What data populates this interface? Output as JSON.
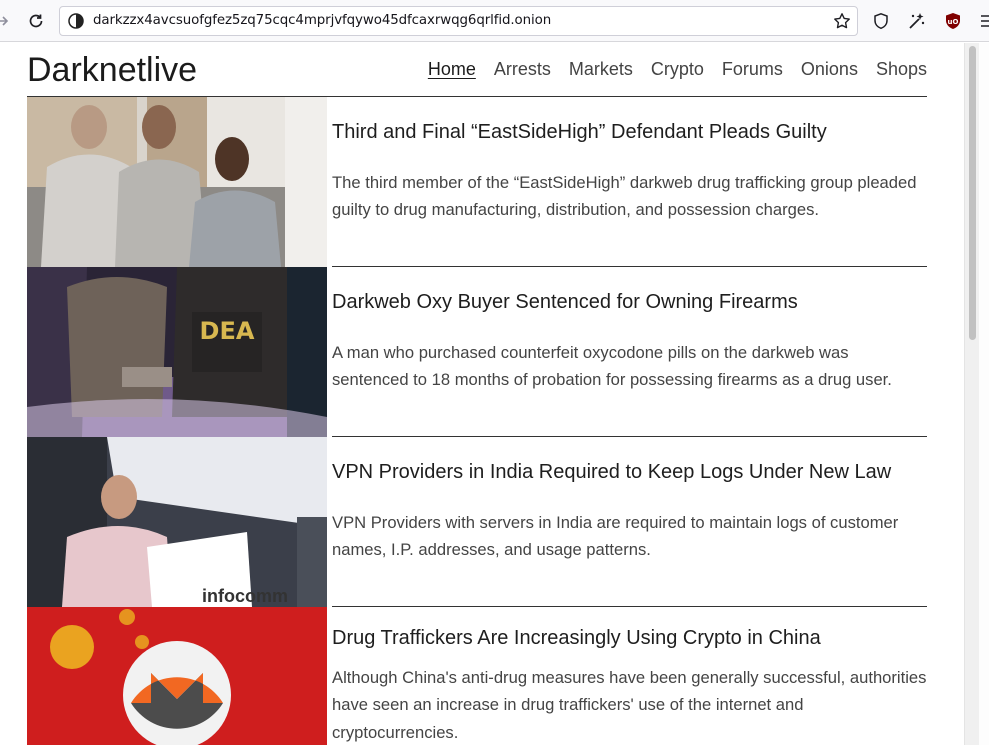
{
  "browser": {
    "url": "darkzzx4avcsuofgfez5zq75cqc4mprjvfqywo45dfcaxrwqg6qrlfid.onion"
  },
  "site": {
    "title": "Darknetlive",
    "nav": [
      "Home",
      "Arrests",
      "Markets",
      "Crypto",
      "Forums",
      "Onions",
      "Shops"
    ]
  },
  "articles": [
    {
      "title": "Third and Final “EastSideHigh” Defendant Pleads Guilty",
      "description": "The third member of the “EastSideHigh” darkweb drug trafficking group pleaded guilty to drug manufacturing, distribution, and possession charges."
    },
    {
      "title": "Darkweb Oxy Buyer Sentenced for Owning Firearms",
      "description": "A man who purchased counterfeit oxycodone pills on the darkweb was sentenced to 18 months of probation for possessing firearms as a drug user."
    },
    {
      "title": "VPN Providers in India Required to Keep Logs Under New Law",
      "description": "VPN Providers with servers in India are required to maintain logs of customer names, I.P. addresses, and usage patterns.",
      "image_text": "infocomm"
    },
    {
      "title": "Drug Traffickers Are Increasingly Using Crypto in China",
      "description": "Although China's anti-drug measures have been generally successful, authorities have seen an increase in drug traffickers' use of the internet and cryptocurrencies."
    }
  ]
}
